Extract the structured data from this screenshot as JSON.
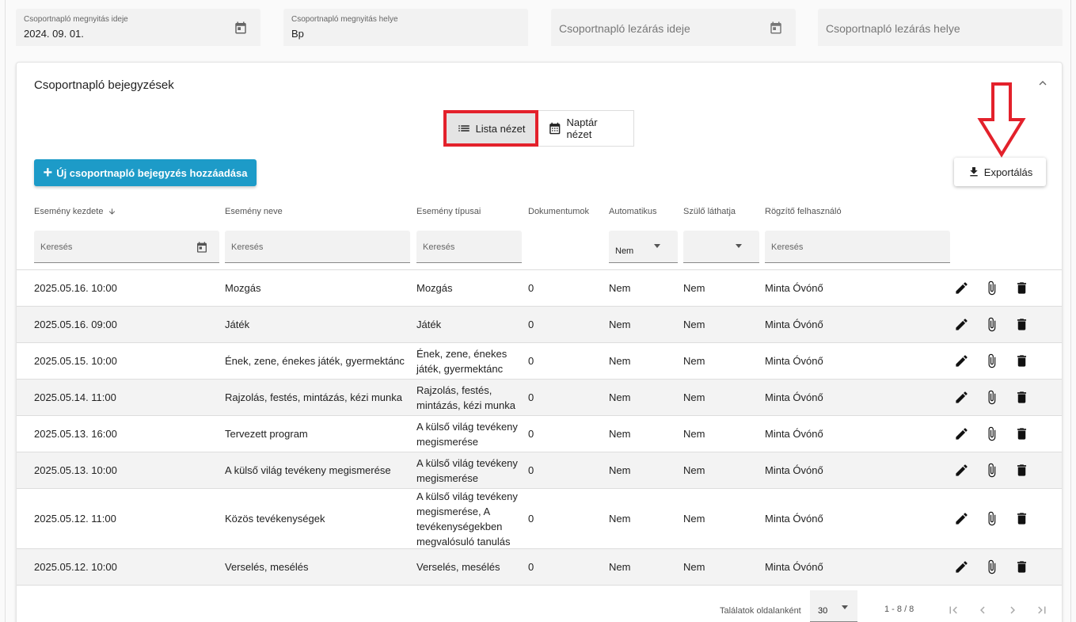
{
  "header_fields": {
    "open_date": {
      "label": "Csoportnapló megnyitás ideje",
      "value": "2024. 09. 01."
    },
    "open_place": {
      "label": "Csoportnapló megnyitás helye",
      "value": "Bp"
    },
    "close_date": {
      "placeholder": "Csoportnapló lezárás ideje"
    },
    "close_place": {
      "placeholder": "Csoportnapló lezárás helye"
    }
  },
  "panel": {
    "title": "Csoportnapló bejegyzések",
    "view_toggle": {
      "list": "Lista nézet",
      "calendar": "Naptár nézet"
    },
    "add_button": "Új csoportnapló bejegyzés hozzáadása",
    "export_button": "Exportálás"
  },
  "columns": {
    "start": "Esemény kezdete",
    "name": "Esemény neve",
    "types": "Esemény típusai",
    "docs": "Dokumentumok",
    "auto": "Automatikus",
    "parent": "Szülő láthatja",
    "user": "Rögzítő felhasználó"
  },
  "filters": {
    "search_placeholder": "Keresés",
    "auto_value": "Nem",
    "parent_value": ""
  },
  "rows": [
    {
      "start": "2025.05.16. 10:00",
      "name": "Mozgás",
      "types": "Mozgás",
      "docs": "0",
      "auto": "Nem",
      "parent": "Nem",
      "user": "Minta Óvónő"
    },
    {
      "start": "2025.05.16. 09:00",
      "name": "Játék",
      "types": "Játék",
      "docs": "0",
      "auto": "Nem",
      "parent": "Nem",
      "user": "Minta Óvónő"
    },
    {
      "start": "2025.05.15. 10:00",
      "name": "Ének, zene, énekes játék, gyermektánc",
      "types": "Ének, zene, énekes játék, gyermektánc",
      "docs": "0",
      "auto": "Nem",
      "parent": "Nem",
      "user": "Minta Óvónő"
    },
    {
      "start": "2025.05.14. 11:00",
      "name": "Rajzolás, festés, mintázás, kézi munka",
      "types": "Rajzolás, festés, mintázás, kézi munka",
      "docs": "0",
      "auto": "Nem",
      "parent": "Nem",
      "user": "Minta Óvónő"
    },
    {
      "start": "2025.05.13. 16:00",
      "name": "Tervezett program",
      "types": "A külső világ tevékeny megismerése",
      "docs": "0",
      "auto": "Nem",
      "parent": "Nem",
      "user": "Minta Óvónő"
    },
    {
      "start": "2025.05.13. 10:00",
      "name": "A külső világ tevékeny megismerése",
      "types": "A külső világ tevékeny megismerése",
      "docs": "0",
      "auto": "Nem",
      "parent": "Nem",
      "user": "Minta Óvónő"
    },
    {
      "start": "2025.05.12. 11:00",
      "name": "Közös tevékenységek",
      "types": "A külső világ tevékeny megismerése, A tevékenységekben megvalósuló tanulás",
      "docs": "0",
      "auto": "Nem",
      "parent": "Nem",
      "user": "Minta Óvónő"
    },
    {
      "start": "2025.05.12. 10:00",
      "name": "Verselés, mesélés",
      "types": "Verselés, mesélés",
      "docs": "0",
      "auto": "Nem",
      "parent": "Nem",
      "user": "Minta Óvónő"
    }
  ],
  "pagination": {
    "per_page_label": "Találatok oldalanként",
    "per_page_value": "30",
    "range": "1 - 8 / 8"
  },
  "colors": {
    "accent": "#1d9bc8",
    "highlight": "#e3212b"
  },
  "icons": [
    "calendar-icon",
    "list-icon",
    "plus-icon",
    "download-icon",
    "arrow-down-icon",
    "chevron-up-icon",
    "edit-icon",
    "attachment-icon",
    "delete-icon",
    "first-page-icon",
    "prev-page-icon",
    "next-page-icon",
    "last-page-icon"
  ]
}
